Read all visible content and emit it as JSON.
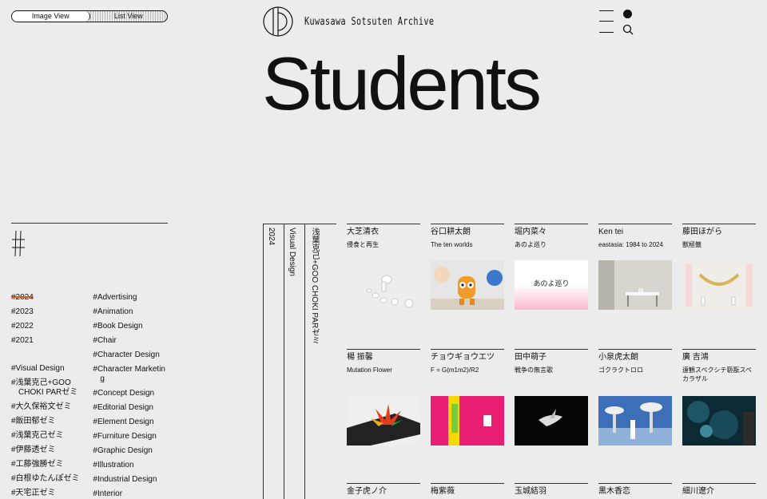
{
  "view_toggle": {
    "image_view": "Image View",
    "list_view": "List View"
  },
  "logo": {
    "text": "Kuwasawa Sotsuten Archive"
  },
  "page_title": "Students",
  "filters": {
    "years": [
      "#2024",
      "#2023",
      "#2022",
      "#2021"
    ],
    "courses": [
      "#Visual Design",
      "#浅葉克己+GOO CHOKI PARゼミ",
      "#大久保裕文ゼミ",
      "#飯田郁ゼミ",
      "#浅葉克己ゼミ",
      "#伊藤透ゼミ",
      "#工藤強勝ゼミ",
      "#白根ゆたんぽゼミ",
      "#天宅正ゼミ"
    ],
    "categories": [
      "#Advertising",
      "#Animation",
      "#Book Design",
      "#Chair",
      "#Character Design",
      "#Character Marketing",
      "#Concept Design",
      "#Editorial Design",
      "#Element Design",
      "#Furniture Design",
      "#Graphic Design",
      "#Illustration",
      "#Industrial Design",
      "#Interior"
    ]
  },
  "breadcrumb": {
    "year": "2024",
    "course": "Visual Design",
    "seminar": "浅葉克己+GOO CHOKI PARゼミ"
  },
  "students": [
    {
      "name": "大芝清衣",
      "work": "侵食と再生"
    },
    {
      "name": "谷口耕太朗",
      "work": "The ten worlds"
    },
    {
      "name": "堀内菜々",
      "work": "あのよ巡り"
    },
    {
      "name": "Ken tei",
      "work": "eastasia: 1984 to 2024"
    },
    {
      "name": "藤田ほがら",
      "work": "獣極籤"
    },
    {
      "name": "楊 振馨",
      "work": "Mutation Flower"
    },
    {
      "name": "チョウギョウエツ",
      "work": "F = G(m1m2)/R2"
    },
    {
      "name": "田中萌子",
      "work": "戦争の無言歌"
    },
    {
      "name": "小泉虎太朗",
      "work": "ゴクラクトロロ"
    },
    {
      "name": "廣 吉鴻",
      "work": "遠観スペクシテ褻翫スペカラザル"
    },
    {
      "name": "金子虎ノ介",
      "work": ""
    },
    {
      "name": "梅紫薇",
      "work": ""
    },
    {
      "name": "玉城結羽",
      "work": ""
    },
    {
      "name": "黒木香恋",
      "work": ""
    },
    {
      "name": "細川遼介",
      "work": ""
    }
  ],
  "thumb_texts": {
    "anoyo": "あのよ巡り"
  },
  "colors": {
    "background": "#ececec",
    "accent_strike": "#e8501a",
    "text": "#111111"
  },
  "icons": [
    "menu-icon",
    "dot-icon",
    "search-icon",
    "hash-icon",
    "logo-mark"
  ]
}
